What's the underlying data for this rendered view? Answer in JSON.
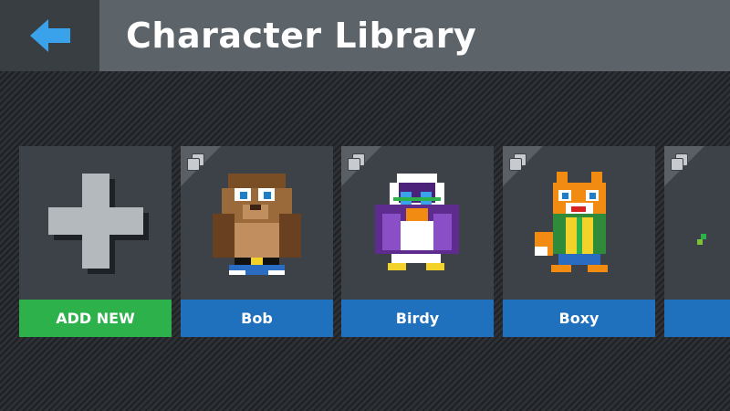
{
  "header": {
    "title": "Character Library",
    "back_icon": "arrow-left-icon",
    "back_color": "#3aa2ea"
  },
  "add_card": {
    "label": "ADD NEW",
    "icon": "plus-icon",
    "color": "#2db14a"
  },
  "characters": [
    {
      "name": "Bob",
      "sprite": "bear",
      "icon": "copy-icon"
    },
    {
      "name": "Birdy",
      "sprite": "bird",
      "icon": "copy-icon"
    },
    {
      "name": "Boxy",
      "sprite": "fox",
      "icon": "copy-icon"
    },
    {
      "name": "",
      "sprite": "partial",
      "icon": "copy-icon"
    }
  ],
  "colors": {
    "card_label": "#1f70bd",
    "card_bg": "#3d4248",
    "header_bg": "#5c6369"
  }
}
